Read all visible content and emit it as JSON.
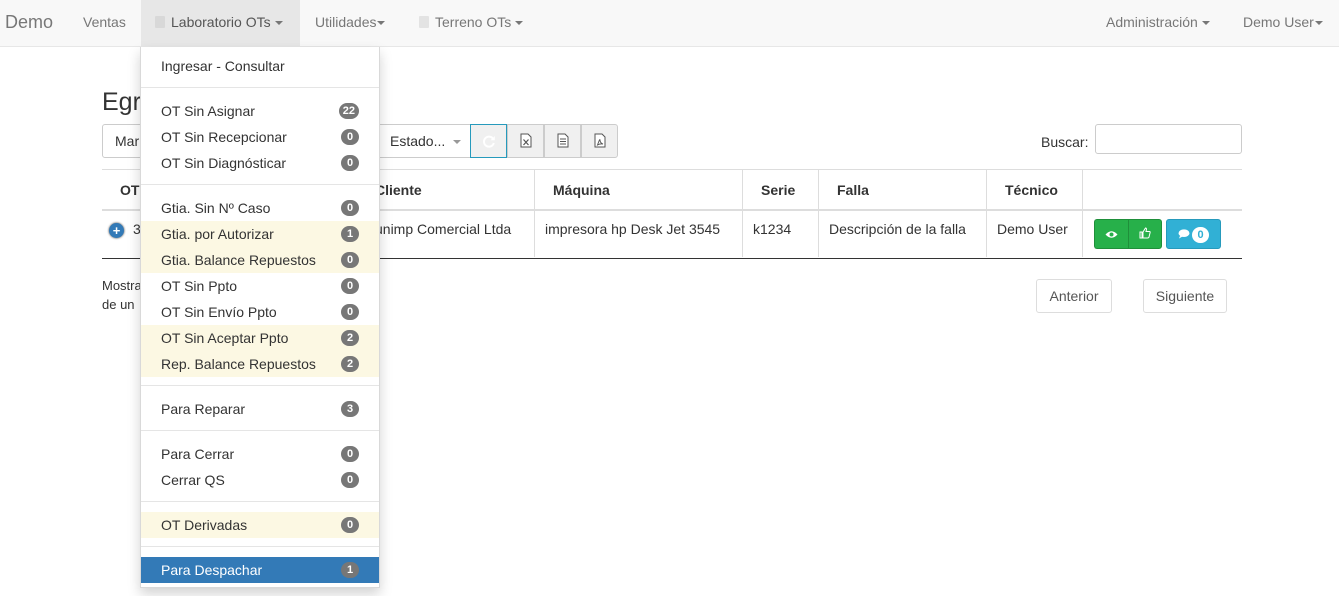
{
  "navbar": {
    "brand": "Demo",
    "items": [
      {
        "label": "Ventas"
      },
      {
        "label": "Laboratorio OTs"
      },
      {
        "label": "Utilidades"
      },
      {
        "label": "Terreno OTs"
      }
    ],
    "right_items": [
      {
        "label": "Administración"
      },
      {
        "label": "Demo User"
      }
    ]
  },
  "page": {
    "title_partial": "Egr",
    "toolbar": {
      "marca_partial": "Mar",
      "estado_label": "Estado...",
      "refresh_icon": "refresh-icon",
      "excel_icon": "excel-icon",
      "doc_icon": "document-icon",
      "pdf_icon": "pdf-icon"
    },
    "search_label": "Buscar:",
    "search_value": ""
  },
  "table": {
    "headers": [
      "OT",
      "Cliente",
      "Máquina",
      "Serie",
      "Falla",
      "Técnico"
    ],
    "rows": [
      {
        "ot": "3",
        "cliente": "unimp Comercial Ltda",
        "maquina": "impresora hp Desk Jet 3545",
        "serie": "k1234",
        "falla": "Descripción de la falla",
        "tecnico": "Demo User",
        "comments": "0"
      }
    ]
  },
  "footer": {
    "info_line1": "Mostra",
    "info_line2": "de un",
    "prev": "Anterior",
    "next": "Siguiente"
  },
  "dropdown": {
    "top_item": "Ingresar - Consultar",
    "items": [
      {
        "label": "OT Sin Asignar",
        "count": "22"
      },
      {
        "label": "OT Sin Recepcionar",
        "count": "0"
      },
      {
        "label": "OT Sin Diagnósticar",
        "count": "0"
      },
      {
        "label": "Gtia. Sin Nº Caso",
        "count": "0"
      },
      {
        "label": "Gtia. por Autorizar",
        "count": "1"
      },
      {
        "label": "Gtia. Balance Repuestos",
        "count": "0"
      },
      {
        "label": "OT Sin Ppto",
        "count": "0"
      },
      {
        "label": "OT Sin Envío Ppto",
        "count": "0"
      },
      {
        "label": "OT Sin Aceptar Ppto",
        "count": "2"
      },
      {
        "label": "Rep. Balance Repuestos",
        "count": "2"
      },
      {
        "label": "Para Reparar",
        "count": "3"
      },
      {
        "label": "Para Cerrar",
        "count": "0"
      },
      {
        "label": "Cerrar QS",
        "count": "0"
      },
      {
        "label": "OT Derivadas",
        "count": "0"
      },
      {
        "label": "Para Despachar",
        "count": "1"
      }
    ]
  },
  "colors": {
    "highlight_row": "#fcf8e3",
    "active_item": "#337ab7",
    "badge": "#777777",
    "success": "#27b04a",
    "info": "#31b0d5"
  }
}
